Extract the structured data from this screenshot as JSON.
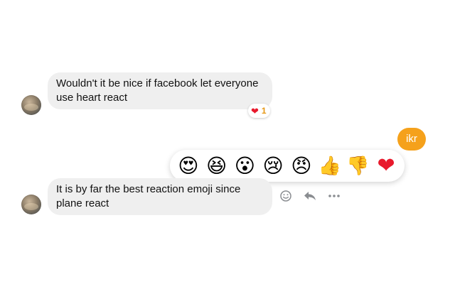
{
  "messages": [
    {
      "side": "incoming",
      "text": "Wouldn't it be nice if facebook let everyone use heart react",
      "reaction": {
        "icon": "heart-icon",
        "count": "1"
      }
    },
    {
      "side": "outgoing",
      "text": "ikr"
    },
    {
      "side": "incoming",
      "text": "It is by far the best reaction emoji since plane react"
    }
  ],
  "reaction_picker": {
    "options": [
      {
        "name": "heart-eyes-emoji",
        "glyph": "😍"
      },
      {
        "name": "laughing-emoji",
        "glyph": "😆"
      },
      {
        "name": "surprised-emoji",
        "glyph": "😮"
      },
      {
        "name": "crying-emoji",
        "glyph": "😢"
      },
      {
        "name": "angry-emoji",
        "glyph": "😠"
      },
      {
        "name": "thumbs-up-emoji",
        "glyph": "👍"
      },
      {
        "name": "thumbs-down-emoji",
        "glyph": "👎"
      },
      {
        "name": "heart-emoji",
        "glyph": "❤"
      }
    ]
  },
  "message_actions": [
    {
      "name": "react-smiley-icon"
    },
    {
      "name": "reply-icon"
    },
    {
      "name": "more-options-icon"
    }
  ],
  "colors": {
    "outgoing_bubble": "#f5a11b",
    "incoming_bubble": "#efefef",
    "reaction_count": "#e69714",
    "heart": "#e8192c"
  }
}
